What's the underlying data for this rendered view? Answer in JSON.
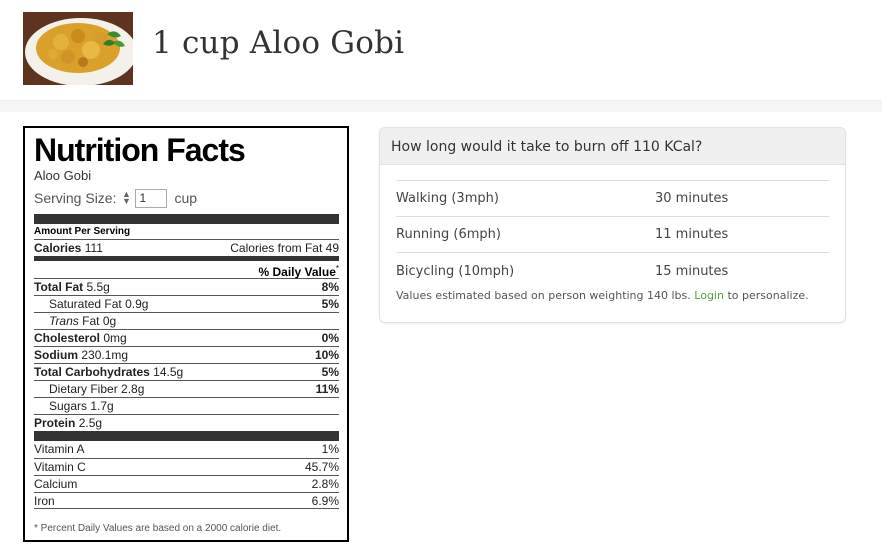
{
  "header": {
    "title": "1 cup Aloo Gobi",
    "image_alt": "aloo gobi dish"
  },
  "nutrition": {
    "title": "Nutrition Facts",
    "food_name": "Aloo Gobi",
    "serving_label": "Serving Size:",
    "serving_qty": "1",
    "serving_unit": "cup",
    "amount_per_serving": "Amount Per Serving",
    "calories_label": "Calories",
    "calories_value": "111",
    "calories_fat_label": "Calories from Fat",
    "calories_fat_value": "49",
    "daily_value_head": "% Daily Value",
    "daily_value_mark": "*",
    "rows": {
      "total_fat": {
        "label": "Total Fat",
        "amount": "5.5g",
        "dv": "8%"
      },
      "saturated_fat": {
        "label": "Saturated Fat",
        "amount": "0.9g",
        "dv": "5%"
      },
      "trans_fat": {
        "label_italic": "Trans",
        "label": "Fat",
        "amount": "0g"
      },
      "cholesterol": {
        "label": "Cholesterol",
        "amount": "0mg",
        "dv": "0%"
      },
      "sodium": {
        "label": "Sodium",
        "amount": "230.1mg",
        "dv": "10%"
      },
      "total_carbs": {
        "label": "Total Carbohydrates",
        "amount": "14.5g",
        "dv": "5%"
      },
      "dietary_fiber": {
        "label": "Dietary Fiber",
        "amount": "2.8g",
        "dv": "11%"
      },
      "sugars": {
        "label": "Sugars",
        "amount": "1.7g"
      },
      "protein": {
        "label": "Protein",
        "amount": "2.5g"
      }
    },
    "vitamins": [
      {
        "label": "Vitamin A",
        "dv": "1%"
      },
      {
        "label": "Vitamin C",
        "dv": "45.7%"
      },
      {
        "label": "Calcium",
        "dv": "2.8%"
      },
      {
        "label": "Iron",
        "dv": "6.9%"
      }
    ],
    "footnote": "* Percent Daily Values are based on a 2000 calorie diet."
  },
  "burn": {
    "heading": "How long would it take to burn off 110 KCal?",
    "rows": [
      {
        "activity": "Walking (3mph)",
        "time": "30 minutes"
      },
      {
        "activity": "Running (6mph)",
        "time": "11 minutes"
      },
      {
        "activity": "Bicycling (10mph)",
        "time": "15 minutes"
      }
    ],
    "note_prefix": "Values estimated based on person weighting 140 lbs.",
    "login_label": "Login",
    "note_suffix": "to personalize.",
    "link_color": "#5a9e3c"
  }
}
